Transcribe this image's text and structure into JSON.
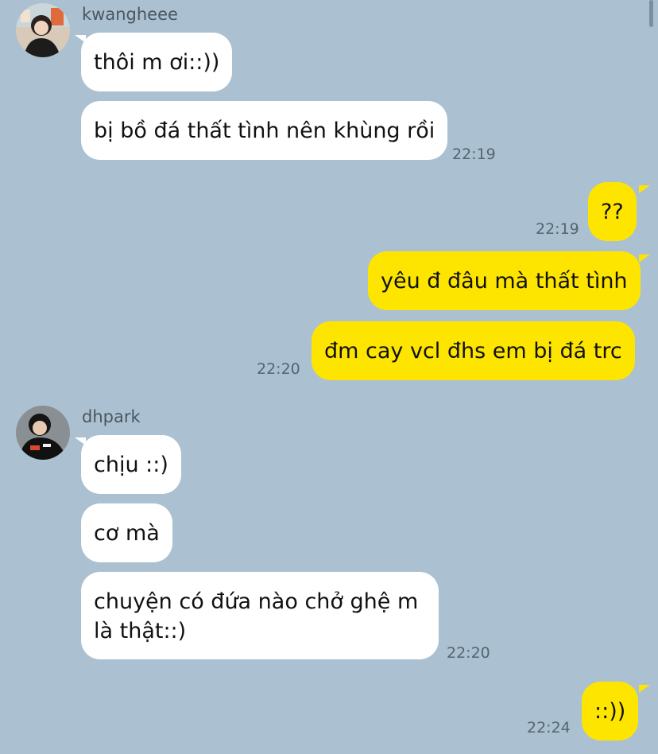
{
  "colors": {
    "background": "#abc1d1",
    "incoming_bubble": "#ffffff",
    "outgoing_bubble": "#fee500"
  },
  "group1": {
    "sender": "kwangheee",
    "avatar_icon": "user-photo-icon",
    "messages": [
      "thôi m ơi::))",
      "bị bồ đá thất tình nên khùng rồi"
    ],
    "time": "22:19"
  },
  "group2": {
    "messages": [
      "??"
    ],
    "time": "22:19"
  },
  "group3": {
    "messages": [
      "yêu đ đâu mà thất tình",
      "đm cay vcl đhs em bị đá trc"
    ],
    "time": "22:20"
  },
  "group4": {
    "sender": "dhpark",
    "avatar_icon": "user-photo-icon",
    "messages": [
      "chịu ::)",
      "cơ mà",
      "chuyện có đứa nào chở ghệ m là thật::)"
    ],
    "time": "22:20"
  },
  "group5": {
    "messages": [
      "::))"
    ],
    "time": "22:24"
  }
}
